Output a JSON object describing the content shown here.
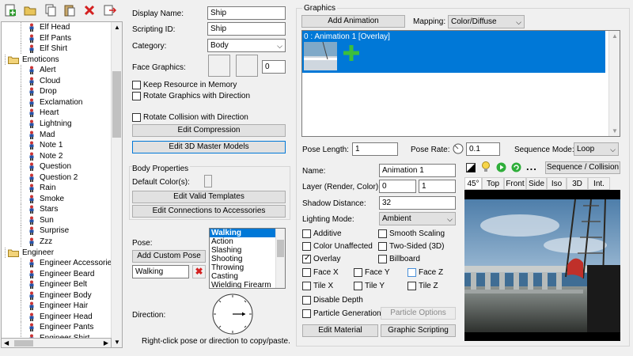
{
  "toolbar": {
    "icons": [
      "new-icon",
      "open-folder-icon",
      "copy-icon",
      "paste-icon",
      "delete-icon",
      "export-icon"
    ]
  },
  "tree": {
    "rows": [
      {
        "type": "item",
        "label": "Elf Head",
        "indent": 2
      },
      {
        "type": "item",
        "label": "Elf Pants",
        "indent": 2
      },
      {
        "type": "item",
        "label": "Elf Shirt",
        "indent": 2
      },
      {
        "type": "folder",
        "label": "Emoticons",
        "indent": 1
      },
      {
        "type": "item",
        "label": "Alert",
        "indent": 2
      },
      {
        "type": "item",
        "label": "Cloud",
        "indent": 2
      },
      {
        "type": "item",
        "label": "Drop",
        "indent": 2
      },
      {
        "type": "item",
        "label": "Exclamation",
        "indent": 2
      },
      {
        "type": "item",
        "label": "Heart",
        "indent": 2
      },
      {
        "type": "item",
        "label": "Lightning",
        "indent": 2
      },
      {
        "type": "item",
        "label": "Mad",
        "indent": 2
      },
      {
        "type": "item",
        "label": "Note 1",
        "indent": 2
      },
      {
        "type": "item",
        "label": "Note 2",
        "indent": 2
      },
      {
        "type": "item",
        "label": "Question",
        "indent": 2
      },
      {
        "type": "item",
        "label": "Question 2",
        "indent": 2
      },
      {
        "type": "item",
        "label": "Rain",
        "indent": 2
      },
      {
        "type": "item",
        "label": "Smoke",
        "indent": 2
      },
      {
        "type": "item",
        "label": "Stars",
        "indent": 2
      },
      {
        "type": "item",
        "label": "Sun",
        "indent": 2
      },
      {
        "type": "item",
        "label": "Surprise",
        "indent": 2
      },
      {
        "type": "item",
        "label": "Zzz",
        "indent": 2
      },
      {
        "type": "folder",
        "label": "Engineer",
        "indent": 1
      },
      {
        "type": "item",
        "label": "Engineer Accessories",
        "indent": 2
      },
      {
        "type": "item",
        "label": "Engineer Beard",
        "indent": 2
      },
      {
        "type": "item",
        "label": "Engineer Belt",
        "indent": 2
      },
      {
        "type": "item",
        "label": "Engineer Body",
        "indent": 2
      },
      {
        "type": "item",
        "label": "Engineer Hair",
        "indent": 2
      },
      {
        "type": "item",
        "label": "Engineer Head",
        "indent": 2
      },
      {
        "type": "item",
        "label": "Engineer Pants",
        "indent": 2
      },
      {
        "type": "item",
        "label": "Engineer Shirt",
        "indent": 2
      }
    ]
  },
  "props": {
    "display_name_label": "Display Name:",
    "display_name": "Ship",
    "scripting_id_label": "Scripting ID:",
    "scripting_id": "Ship",
    "category_label": "Category:",
    "category": "Body",
    "face_graphics_label": "Face Graphics:",
    "face_value": "0",
    "keep_resource": "Keep Resource in Memory",
    "rotate_graphics": "Rotate Graphics with Direction",
    "rotate_collision": "Rotate Collision with Direction",
    "edit_compression": "Edit Compression",
    "edit_3d_master": "Edit 3D Master Models",
    "body_properties": "Body Properties",
    "default_colors": "Default Color(s):",
    "edit_valid_templates": "Edit Valid Templates",
    "edit_connections": "Edit Connections to Accessories",
    "pose_label": "Pose:",
    "add_custom_pose": "Add Custom Pose",
    "pose_value": "Walking",
    "poses": [
      "Walking",
      "Action",
      "Slashing",
      "Shooting",
      "Throwing",
      "Casting",
      "Wielding Firearm"
    ],
    "direction_label": "Direction:",
    "hint": "Right-click pose or direction to copy/paste."
  },
  "graphics": {
    "group_label": "Graphics",
    "add_animation": "Add Animation",
    "mapping_label": "Mapping:",
    "mapping": "Color/Diffuse",
    "animation_item": "0 : Animation 1 [Overlay]",
    "pose_length_label": "Pose Length:",
    "pose_length": "1",
    "pose_rate_label": "Pose Rate:",
    "pose_rate": "0.1",
    "sequence_mode_label": "Sequence Mode:",
    "sequence_mode": "Loop",
    "name_label": "Name:",
    "name": "Animation 1",
    "layer_label": "Layer (Render, Color):",
    "layer_render": "0",
    "layer_color": "1",
    "shadow_label": "Shadow Distance:",
    "shadow": "32",
    "lighting_label": "Lighting Mode:",
    "lighting": "Ambient",
    "additive": "Additive",
    "smooth_scaling": "Smooth Scaling",
    "color_unaffected": "Color Unaffected",
    "two_sided": "Two-Sided (3D)",
    "overlay": "Overlay",
    "billboard": "Billboard",
    "face_x": "Face X",
    "face_y": "Face Y",
    "face_z": "Face Z",
    "tile_x": "Tile X",
    "tile_y": "Tile Y",
    "tile_z": "Tile Z",
    "disable_depth": "Disable Depth",
    "particle_generation": "Particle Generation",
    "particle_options": "Particle Options",
    "edit_material": "Edit Material",
    "graphic_scripting": "Graphic Scripting",
    "more": "...",
    "sequence_collision": "Sequence / Collision",
    "view_tabs": [
      "45°",
      "Top",
      "Front",
      "Side",
      "Iso",
      "3D",
      "Int."
    ]
  }
}
